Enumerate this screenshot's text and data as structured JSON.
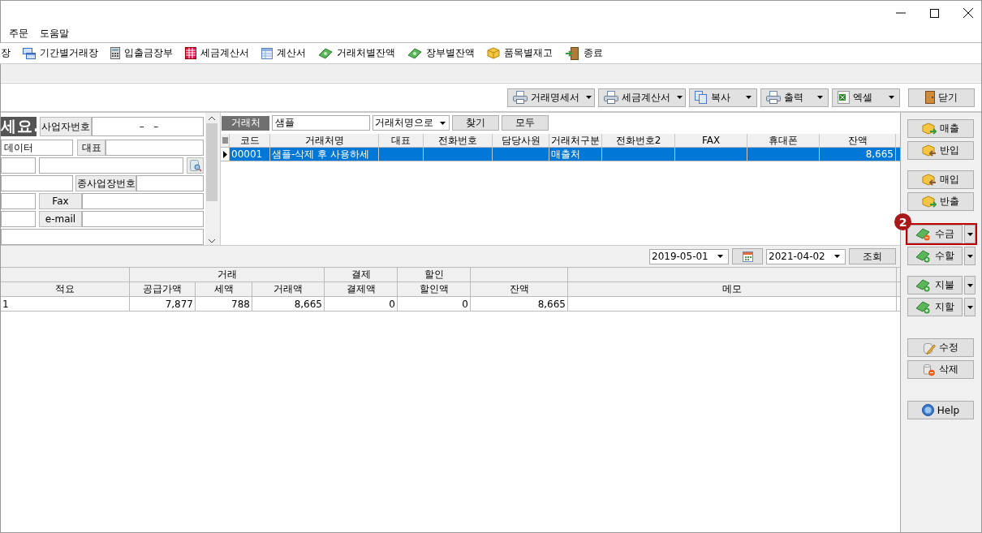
{
  "menu": [
    "주문",
    "도움말"
  ],
  "toolbar": [
    {
      "label": "장"
    },
    {
      "label": "기간별거래장"
    },
    {
      "label": "입출금장부"
    },
    {
      "label": "세금계산서"
    },
    {
      "label": "계산서"
    },
    {
      "label": "거래처별잔액"
    },
    {
      "label": "장부별잔액"
    },
    {
      "label": "품목별재고"
    },
    {
      "label": "종료"
    }
  ],
  "action_buttons": [
    {
      "label": "거래명세서",
      "dropdown": true
    },
    {
      "label": "세금계산서",
      "dropdown": true
    },
    {
      "label": "복사",
      "dropdown": true
    },
    {
      "label": "출력",
      "dropdown": true
    },
    {
      "label": "엑셀",
      "dropdown": true
    },
    {
      "label": "닫기",
      "dropdown": false
    }
  ],
  "form": {
    "rows": [
      [
        {
          "kind": "banner",
          "text": "세요."
        },
        {
          "kind": "label",
          "text": "사업자번호"
        },
        {
          "kind": "field",
          "value": "–   –"
        }
      ],
      [
        {
          "kind": "field",
          "value": "데이터"
        },
        {
          "kind": "label",
          "text": "대표"
        },
        {
          "kind": "field"
        }
      ],
      [
        {
          "kind": "field"
        },
        {
          "kind": "field"
        },
        {
          "kind": "icon_button"
        }
      ],
      [
        {
          "kind": "field"
        },
        {
          "kind": "label",
          "text": "종사업장번호"
        },
        {
          "kind": "field"
        }
      ],
      [
        {
          "kind": "field"
        },
        {
          "kind": "label",
          "text": "Fax"
        },
        {
          "kind": "field"
        }
      ],
      [
        {
          "kind": "field"
        },
        {
          "kind": "label",
          "text": "e-mail"
        },
        {
          "kind": "field"
        }
      ],
      [
        {
          "kind": "field"
        }
      ]
    ]
  },
  "customer_search": {
    "label": "거래처",
    "value": "샘플",
    "mode": "거래처명으로",
    "buttons": [
      "찾기",
      "모두"
    ]
  },
  "customer_list": {
    "columns": [
      "코드",
      "거래처명",
      "대표",
      "전화번호",
      "담당사원",
      "거래처구분",
      "전화번호2",
      "FAX",
      "휴대폰",
      "잔액"
    ],
    "rows": [
      {
        "selected": true,
        "cells": [
          "00001",
          "샘플-삭제 후 사용하세",
          "",
          "",
          "",
          "매출처",
          "",
          "",
          "",
          "8,665"
        ]
      }
    ]
  },
  "date_filter": {
    "from": "2019-05-01",
    "to": "2021-04-02",
    "button": "조회"
  },
  "ledger": {
    "groups": [
      {
        "label": "거래"
      },
      {
        "label": "결제"
      },
      {
        "label": "할인"
      }
    ],
    "columns": [
      "적요",
      "공급가액",
      "세액",
      "거래액",
      "결제액",
      "할인액",
      "잔액",
      "메모"
    ],
    "rows": [
      [
        "1",
        "7,877",
        "788",
        "8,665",
        "0",
        "0",
        "8,665",
        ""
      ]
    ]
  },
  "sidebar": {
    "groups": [
      [
        {
          "label": "매출",
          "dropdown": false,
          "highlighted": false
        },
        {
          "label": "반입",
          "dropdown": false,
          "highlighted": false
        }
      ],
      [
        {
          "label": "매입",
          "dropdown": false,
          "highlighted": false
        },
        {
          "label": "반출",
          "dropdown": false,
          "highlighted": false
        }
      ],
      [
        {
          "label": "수금",
          "dropdown": true,
          "highlighted": true,
          "badge": "2"
        },
        {
          "label": "수할",
          "dropdown": true,
          "highlighted": false
        }
      ],
      [
        {
          "label": "지불",
          "dropdown": true,
          "highlighted": false
        },
        {
          "label": "지할",
          "dropdown": true,
          "highlighted": false
        }
      ],
      [
        {
          "label": "수정",
          "dropdown": false,
          "highlighted": false
        },
        {
          "label": "삭제",
          "dropdown": false,
          "highlighted": false
        }
      ],
      [
        {
          "label": "Help",
          "dropdown": false,
          "highlighted": false
        }
      ]
    ]
  }
}
